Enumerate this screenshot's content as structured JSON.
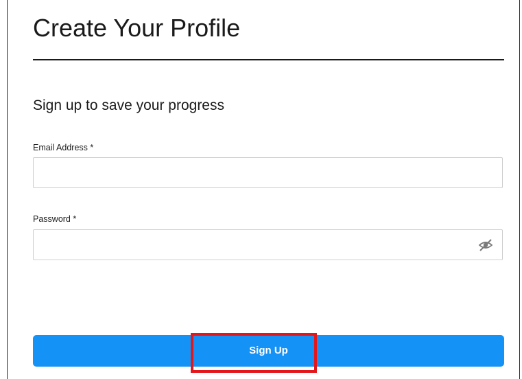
{
  "header": {
    "title": "Create Your Profile"
  },
  "form": {
    "subtitle": "Sign up to save your progress",
    "email": {
      "label": "Email Address *",
      "value": "",
      "placeholder": ""
    },
    "password": {
      "label": "Password *",
      "value": "",
      "placeholder": "",
      "toggle_icon": "eye-slash-icon"
    },
    "submit_label": "Sign Up"
  },
  "colors": {
    "button": "#1492f5",
    "highlight": "#e3171b",
    "text": "#1a1a1a",
    "field_border": "#cfcfcf"
  }
}
